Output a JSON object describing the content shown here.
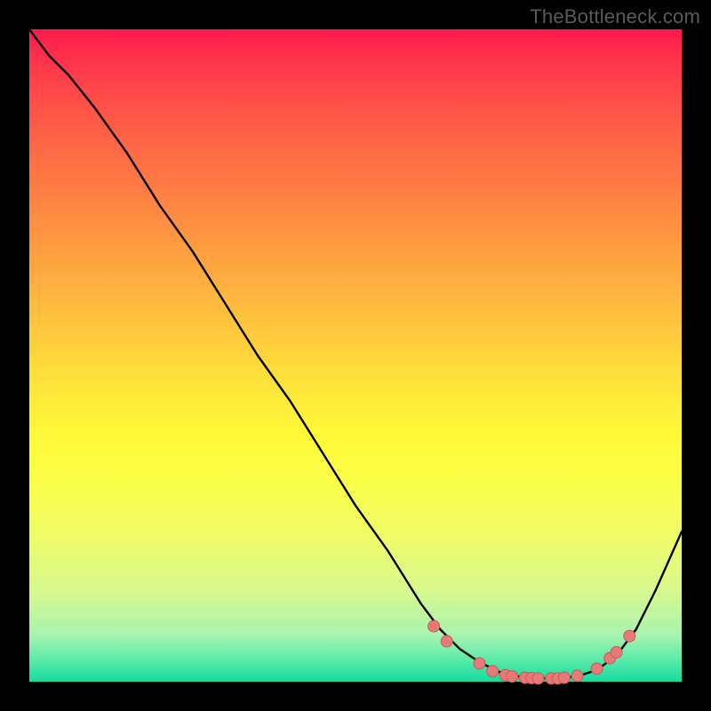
{
  "attribution": "TheBottleneck.com",
  "colors": {
    "frame": "#000000",
    "curve": "#000000",
    "dot_fill": "#e77a77",
    "dot_stroke": "#c95a57"
  },
  "chart_data": {
    "type": "line",
    "title": "",
    "xlabel": "",
    "ylabel": "",
    "xlim": [
      0,
      100
    ],
    "ylim": [
      0,
      100
    ],
    "grid": false,
    "legend": false,
    "series": [
      {
        "name": "curve",
        "x": [
          0,
          3,
          6,
          10,
          15,
          20,
          25,
          30,
          35,
          40,
          45,
          50,
          55,
          60,
          63,
          66,
          69,
          72,
          75,
          78,
          81,
          84,
          87,
          90,
          93,
          96,
          100
        ],
        "y": [
          100,
          96,
          93,
          88,
          81,
          73,
          66,
          58,
          50,
          43,
          35,
          27,
          20,
          12,
          8,
          5,
          3,
          1.5,
          0.8,
          0.5,
          0.5,
          0.8,
          1.8,
          4,
          8,
          14,
          23
        ]
      }
    ],
    "marker_points": {
      "name": "points-on-curve",
      "x": [
        62,
        64,
        69,
        71,
        73,
        74,
        76,
        77,
        78,
        80,
        81,
        82,
        84,
        87,
        89,
        90,
        92
      ],
      "y": [
        8.5,
        6.2,
        2.8,
        1.6,
        1.0,
        0.8,
        0.6,
        0.55,
        0.5,
        0.5,
        0.5,
        0.6,
        0.9,
        2.0,
        3.6,
        4.5,
        7.0
      ]
    }
  }
}
